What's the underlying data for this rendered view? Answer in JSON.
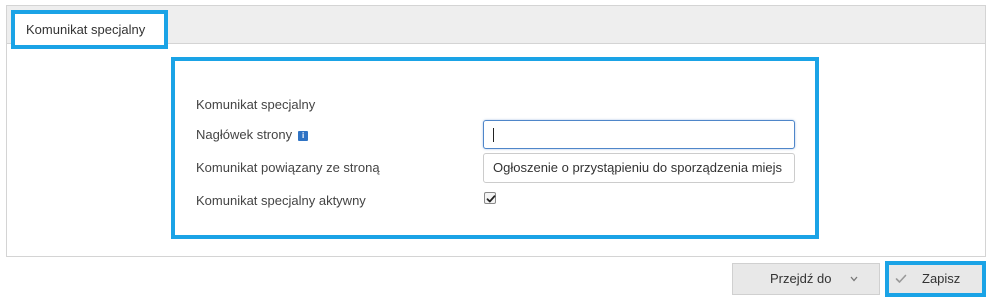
{
  "tabs": [
    {
      "label": "Komunikat specjalny",
      "active": true
    }
  ],
  "form": {
    "section_title": "Komunikat specjalny",
    "header_label": "Nagłówek strony",
    "header_value": "",
    "linked_label": "Komunikat powiązany ze stroną",
    "linked_value": "Ogłoszenie o przystąpieniu do sporządzenia  miejs",
    "active_label": "Komunikat specjalny aktywny",
    "active_checked": true
  },
  "footer": {
    "goto_label": "Przejdź do",
    "save_label": "Zapisz"
  },
  "icons": {
    "info": "info-icon",
    "chevron": "chevron-down-icon",
    "save": "checkmark-icon"
  },
  "colors": {
    "highlight": "#1aa3e6",
    "info_icon": "#2f73c4",
    "focus_border": "#4f86c9"
  }
}
